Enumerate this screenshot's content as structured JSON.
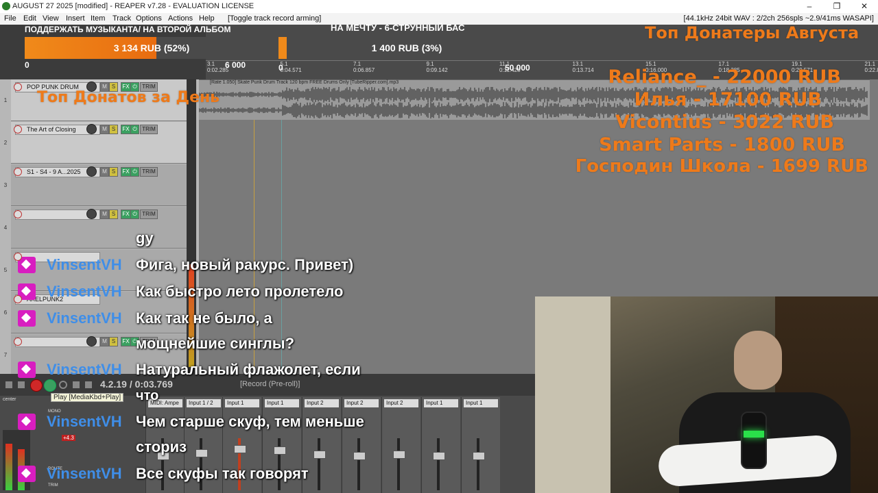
{
  "window": {
    "title": "AUGUST 27 2025 [modified] - REAPER v7.28 - EVALUATION LICENSE",
    "minimize": "–",
    "maximize": "❐",
    "close": "✕"
  },
  "menu": {
    "items": [
      "File",
      "Edit",
      "View",
      "Insert",
      "Item",
      "Track",
      "Options",
      "Actions",
      "Help"
    ],
    "action_hint": "[Toggle track record arming]",
    "status": "[44.1kHz 24bit WAV : 2/2ch 256spls ~2.9/41ms WASAPI]"
  },
  "ruler": {
    "bars": [
      {
        "bar": "3.1",
        "time": "0:02.285"
      },
      {
        "bar": "5.1",
        "time": "0:04.571"
      },
      {
        "bar": "7.1",
        "time": "0:06.857"
      },
      {
        "bar": "9.1",
        "time": "0:09.142"
      },
      {
        "bar": "11.1",
        "time": "0:11.428"
      },
      {
        "bar": "13.1",
        "time": "0:13.714"
      },
      {
        "bar": "15.1",
        "time": "0:16.000"
      },
      {
        "bar": "17.1",
        "time": "0:18.285"
      },
      {
        "bar": "19.1",
        "time": "0:20.571"
      },
      {
        "bar": "21.1",
        "time": "0:22.857"
      }
    ]
  },
  "donation": {
    "goal1": {
      "title": "ПОДДЕРЖАТЬ МУЗЫКАНТА/ НА ВТОРОЙ АЛЬБОМ",
      "amount": "3 134 RUB (52%)",
      "progress": 0.52,
      "min": "0",
      "max": "6 000"
    },
    "goal2": {
      "title": "НА МЕЧТУ - 6-СТРУННЫЙ БАС",
      "amount": "1 400 RUB (3%)",
      "progress": 0.03,
      "min": "0",
      "max": "50 000"
    }
  },
  "top_month": {
    "title": "Топ Донатеры Августа",
    "entries": [
      "Reliance_ - 22000 RUB",
      "Илья - 17100 RUB",
      "Vicontius - 3022 RUB",
      "Smart Parts - 1800 RUB",
      "Господин Школа - 1699 RUB"
    ]
  },
  "top_day": {
    "title": "Топ Донатов за День"
  },
  "tracks": [
    {
      "num": "1",
      "name": "POP PUNK DRUM"
    },
    {
      "num": "2",
      "name": "The Art of Closing"
    },
    {
      "num": "3",
      "name": "S1 - S4 - 9 A...2025"
    },
    {
      "num": "4",
      "name": ""
    },
    {
      "num": "5",
      "name": ""
    },
    {
      "num": "6",
      "name": "AXELPUNK2"
    },
    {
      "num": "7",
      "name": ""
    }
  ],
  "track_buttons": {
    "mute": "M",
    "solo": "S",
    "fx": "FX",
    "io": "⏻",
    "trim": "TRIM"
  },
  "item": {
    "label": "[Rate 1.050] Skate Punk Drum Track 120 bpm FREE Drums Only [TubeRipper.com].mp3"
  },
  "transport": {
    "time": "4.2.19 / 0:03.769",
    "status": "[Record (Pre-roll)]",
    "tooltip": "Play [MediaKbd+Play]"
  },
  "mixer": {
    "inputs": [
      "MIDI: Ampe",
      "Input 1 / 2",
      "Input 1",
      "Input 1",
      "Input 2",
      "Input 2",
      "Input 2",
      "Input 1",
      "Input 1"
    ],
    "pan": "center",
    "mono": "MONO",
    "route": "ROUTE",
    "trim": "TRIM",
    "peak": "+4.3"
  },
  "chat": [
    {
      "name": "",
      "msg": "gy"
    },
    {
      "name": "VinsentVH",
      "msg": "Фига, новый ракурс. Привет)"
    },
    {
      "name": "VinsentVH",
      "msg": "Как быстро лето пролетело"
    },
    {
      "name": "VinsentVH",
      "msg": "Как так не было, а"
    },
    {
      "name": "",
      "msg": "мощнейшие синглы?"
    },
    {
      "name": "VinsentVH",
      "msg": "Натуральный флажолет, если"
    },
    {
      "name": "",
      "msg": "что"
    },
    {
      "name": "VinsentVH",
      "msg": "Чем старше скуф, тем меньше"
    },
    {
      "name": "",
      "msg": "сториз"
    },
    {
      "name": "VinsentVH",
      "msg": "Все скуфы так говорят"
    }
  ],
  "colors": {
    "overlay_orange": "#ee7a1a",
    "chat_name": "#3f8ee8",
    "badge": "#d81ec0",
    "record": "#d02828"
  }
}
